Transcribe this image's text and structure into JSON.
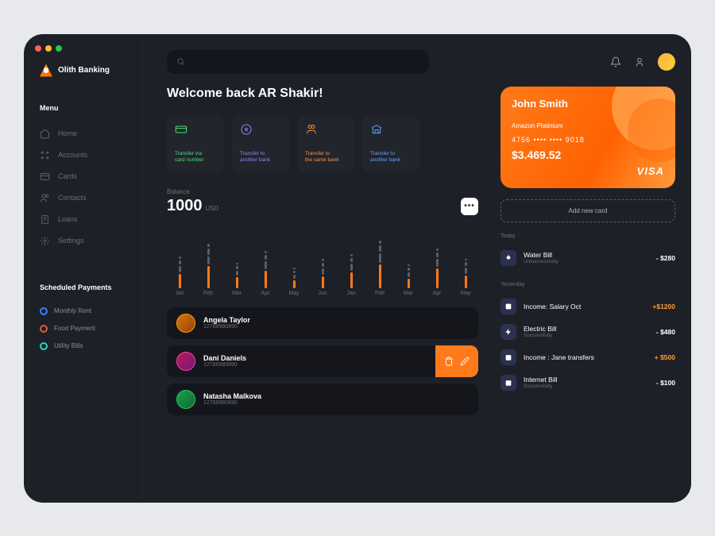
{
  "brand": "Olith Banking",
  "menuLabel": "Menu",
  "nav": [
    "Home",
    "Accounts",
    "Cards",
    "Contacts",
    "Loans",
    "Settings"
  ],
  "schedLabel": "Scheduled Payments",
  "sched": [
    {
      "label": "Monthly Rent",
      "color": "#3b82f6"
    },
    {
      "label": "Food Payment",
      "color": "#dc5a3a"
    },
    {
      "label": "Utility Bills",
      "color": "#2dd4bf"
    }
  ],
  "welcome": "Welcome back AR Shakir!",
  "actions": [
    {
      "line1": "Transfer via",
      "line2": "card number",
      "color": "#4ade80"
    },
    {
      "line1": "Transfer to",
      "line2": "another bank",
      "color": "#818cf8"
    },
    {
      "line1": "Transfer to",
      "line2": "the same bank",
      "color": "#fb923c"
    },
    {
      "line1": "Transfer to",
      "line2": "another bank",
      "color": "#60a5fa"
    }
  ],
  "balanceLabel": "Balance",
  "balanceValue": "1000",
  "balanceCurrency": "USD",
  "chart_data": {
    "type": "bar",
    "categories": [
      "Jan",
      "Feb",
      "Mar",
      "Apr",
      "May",
      "Jun",
      "Jan",
      "Feb",
      "Mar",
      "Apr",
      "May"
    ],
    "series": [
      {
        "name": "orange",
        "values": [
          18,
          28,
          14,
          22,
          10,
          15,
          20,
          30,
          12,
          25,
          16
        ]
      },
      {
        "name": "gray1",
        "values": [
          8,
          10,
          6,
          10,
          5,
          8,
          9,
          12,
          6,
          10,
          8
        ]
      },
      {
        "name": "gray2",
        "values": [
          5,
          8,
          4,
          6,
          3,
          5,
          5,
          8,
          4,
          6,
          5
        ]
      },
      {
        "name": "gray3",
        "values": [
          3,
          4,
          2,
          3,
          2,
          3,
          3,
          4,
          2,
          3,
          2
        ]
      }
    ],
    "ylim": [
      0,
      60
    ]
  },
  "contacts": [
    {
      "name": "Angela Taylor",
      "id": "12788980890",
      "border": "#f59e0b",
      "bg": "linear-gradient(135deg,#d97706,#92400e)"
    },
    {
      "name": "Dani Daniels",
      "id": "12788980890",
      "border": "#ec4899",
      "bg": "linear-gradient(135deg,#be185d,#701a75)",
      "active": true
    },
    {
      "name": "Natasha Malkova",
      "id": "12788980890",
      "border": "#22c55e",
      "bg": "linear-gradient(135deg,#16a34a,#166534)"
    }
  ],
  "card": {
    "name": "John Smith",
    "tier": "Amazon Platinium",
    "number": "4756   ••••   ••••   9018",
    "balance": "$3.469.52",
    "brand": "VISA"
  },
  "addCard": "Add new card",
  "transGroups": [
    {
      "day": "Today",
      "items": [
        {
          "name": "Water Bill",
          "status": "Unsuccessfully",
          "amount": "- $280",
          "type": "neg",
          "icon": "drop"
        }
      ]
    },
    {
      "day": "Yesterday",
      "items": [
        {
          "name": "Income: Salary Oct",
          "status": "",
          "amount": "+$1200",
          "type": "pos",
          "icon": "dollar"
        },
        {
          "name": "Electric Bill",
          "status": "Successfully",
          "amount": "- $480",
          "type": "neg",
          "icon": "bolt"
        },
        {
          "name": "Income : Jane transfers",
          "status": "",
          "amount": "+ $500",
          "type": "pos",
          "icon": "cal"
        },
        {
          "name": "Internet Bill",
          "status": "Successfully",
          "amount": "- $100",
          "type": "neg",
          "icon": "cal"
        }
      ]
    }
  ]
}
